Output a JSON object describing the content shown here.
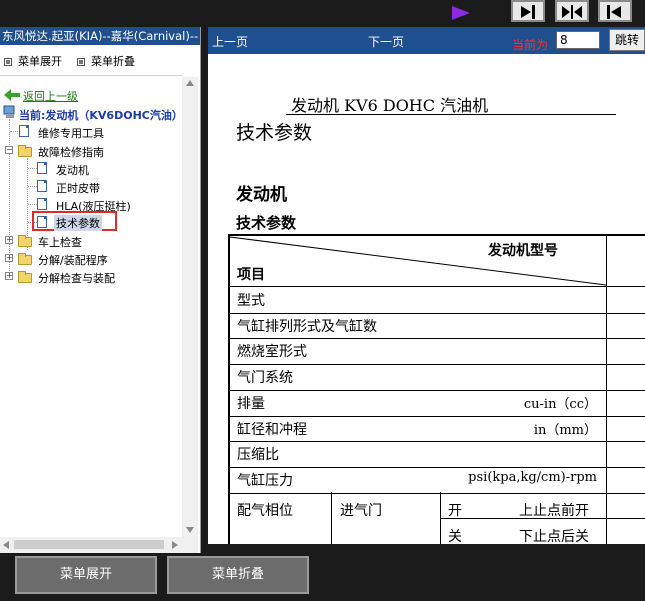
{
  "top_strip": {
    "buttons": [
      {
        "name": "last-page-icon"
      },
      {
        "name": "center-icon"
      },
      {
        "name": "first-page-icon"
      }
    ],
    "accent_color": "#8a2be2"
  },
  "left_panel": {
    "title": "东风悦达.起亚(KIA)--嘉华(Carnival)--",
    "expand_label": "菜单展开",
    "collapse_label": "菜单折叠",
    "back_label": "返回上一级",
    "current_label": "当前:发动机（KV6DOHC汽油）",
    "tree": {
      "tools": "维修专用工具",
      "fault_guide": "故障检修指南",
      "engine": "发动机",
      "timing_belt": "正时皮带",
      "hla": "HLA(液压挺柱)",
      "tech_params": "技术参数",
      "on_car_check": "车上检查",
      "disassembly": "分解/装配程序",
      "disassembly_check": "分解检查与装配"
    }
  },
  "viewer": {
    "prev_label": "上一页",
    "next_label": "下一页",
    "current_label": "当前为",
    "current_page": "8",
    "jump_label": "跳转"
  },
  "document": {
    "header": "发动机 KV6 DOHC 汽油机",
    "title": "技术参数",
    "section": "发动机",
    "subsection": "技术参数",
    "table": {
      "header_right": "发动机型号",
      "header_left": "项目",
      "rows": [
        {
          "label": "型式",
          "unit": ""
        },
        {
          "label": "气缸排列形式及气缸数",
          "unit": ""
        },
        {
          "label": "燃烧室形式",
          "unit": ""
        },
        {
          "label": "气门系统",
          "unit": ""
        },
        {
          "label": "排量",
          "unit": "cu-in（cc）"
        },
        {
          "label": "缸径和冲程",
          "unit": "in（mm）"
        },
        {
          "label": "压缩比",
          "unit": ""
        },
        {
          "label": "气缸压力",
          "unit": "psi(kpa,kg/cm)-rpm"
        }
      ],
      "valve_timing": {
        "label": "配气相位",
        "intake": "进气门",
        "open": "开",
        "open_desc": "上止点前开",
        "close": "关",
        "close_desc": "下止点后关"
      }
    }
  },
  "bottom": {
    "expand_label": "菜单展开",
    "collapse_label": "菜单折叠"
  }
}
